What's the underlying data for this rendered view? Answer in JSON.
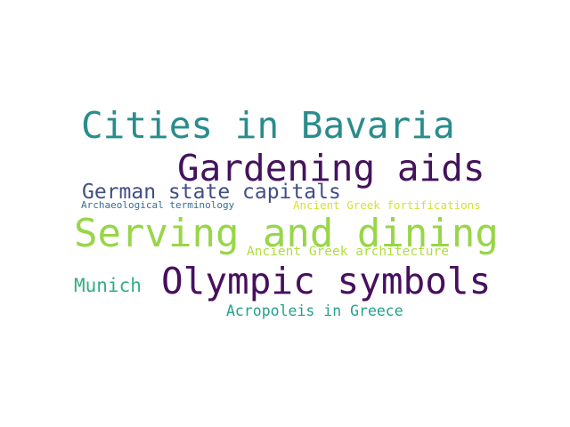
{
  "word_cloud": {
    "words": [
      {
        "text": "Cities in Bavaria",
        "color": "#2a8c8c"
      },
      {
        "text": "Gardening aids",
        "color": "#44135c"
      },
      {
        "text": "German state capitals",
        "color": "#424e86"
      },
      {
        "text": "Archaeological terminology",
        "color": "#356e92"
      },
      {
        "text": "Ancient Greek fortifications",
        "color": "#d5e038"
      },
      {
        "text": "Serving and dining",
        "color": "#98d648"
      },
      {
        "text": "Ancient Greek architecture",
        "color": "#b0dc3c"
      },
      {
        "text": "Munich",
        "color": "#33ad85"
      },
      {
        "text": "Olympic symbols",
        "color": "#480f5e"
      },
      {
        "text": "Acropoleis in Greece",
        "color": "#24a18b"
      }
    ]
  }
}
